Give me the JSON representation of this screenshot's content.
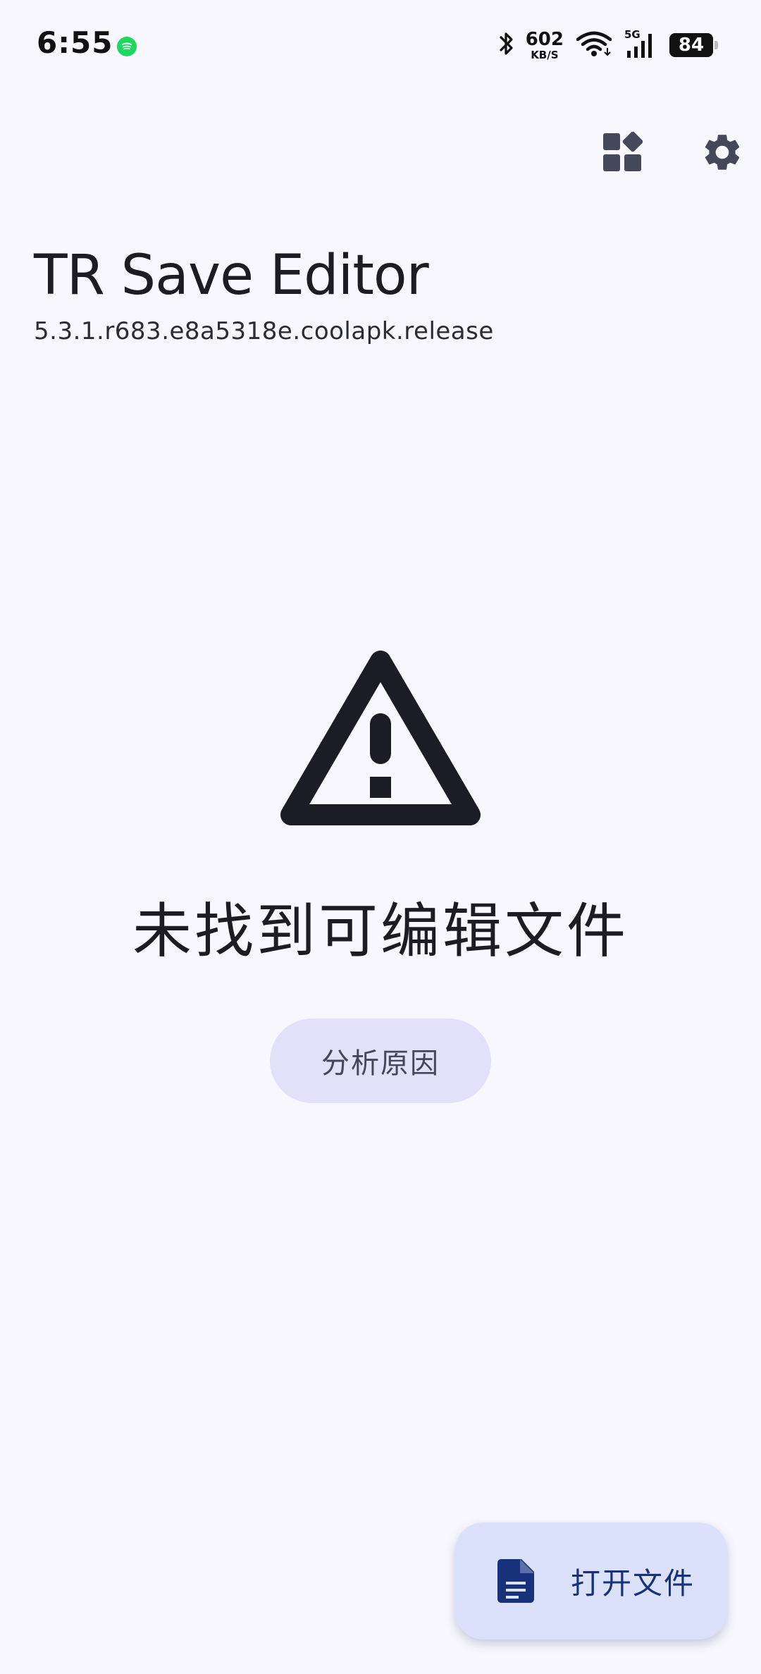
{
  "status_bar": {
    "time": "6:55",
    "net_speed_value": "602",
    "net_speed_unit": "KB/S",
    "network_type": "5G",
    "battery_level": "84"
  },
  "toolbar": {
    "widgets_icon": "widgets-icon",
    "settings_icon": "gear-icon"
  },
  "header": {
    "title": "TR Save Editor",
    "version": "5.3.1.r683.e8a5318e.coolapk.release"
  },
  "empty_state": {
    "icon": "warning-icon",
    "message": "未找到可编辑文件",
    "analyze_button_label": "分析原因"
  },
  "fab": {
    "icon": "document-icon",
    "label": "打开文件"
  },
  "colors": {
    "background": "#f8f7fe",
    "analyze_button_bg": "#e3e0fa",
    "fab_bg": "#dce1fb",
    "fab_accent": "#17327a",
    "icon_dark": "#454858",
    "notification_green": "#1ed760"
  }
}
